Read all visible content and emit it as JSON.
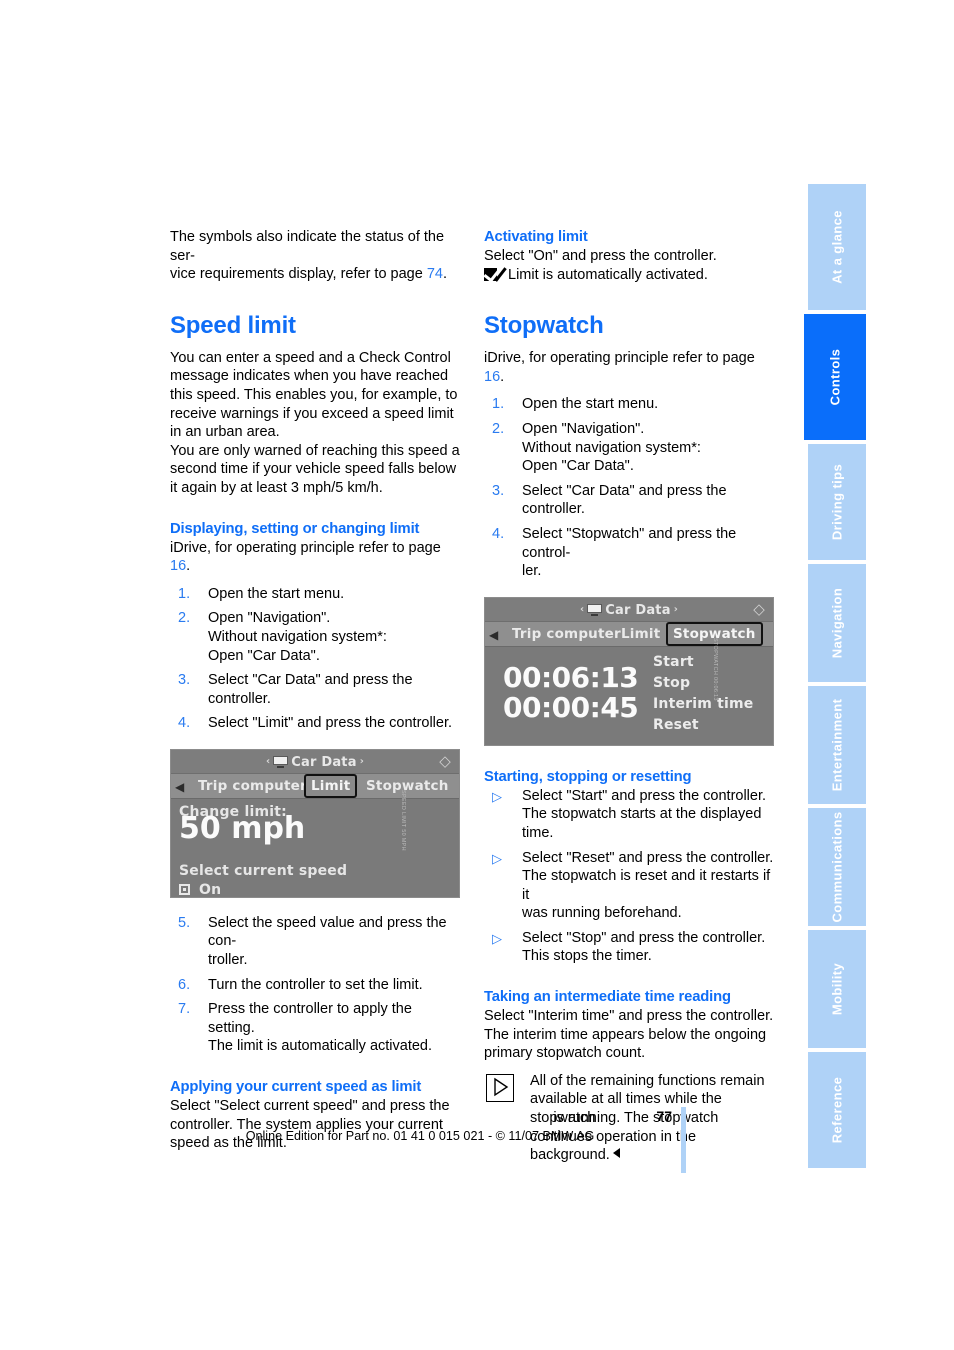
{
  "document": {
    "page_number": "77",
    "edition_line": "Online Edition for Part no. 01 41 0 015 021 - © 11/07 BMW AG"
  },
  "sidenav": {
    "items": [
      {
        "label": "At a glance",
        "active": false
      },
      {
        "label": "Controls",
        "active": true
      },
      {
        "label": "Driving tips",
        "active": false
      },
      {
        "label": "Navigation",
        "active": false
      },
      {
        "label": "Entertainment",
        "active": false
      },
      {
        "label": "Communications",
        "active": false
      },
      {
        "label": "Mobility",
        "active": false
      },
      {
        "label": "Reference",
        "active": false
      }
    ],
    "active_color": "#0a6efa",
    "inactive_color": "#afd2f7"
  },
  "left_column": {
    "intro": {
      "text_before": "The symbols also indicate the status of the ser-vice requirements display, refer to page ",
      "line1": "The symbols also indicate the status of the ser-",
      "line2_before": "vice requirements display, refer to page ",
      "page_ref": "74",
      "line2_after": "."
    },
    "section_title": "Speed limit",
    "intro_para1": "You can enter a speed and a Check Control message indicates when you have reached this speed. This enables you, for example, to receive warnings if you exceed a speed limit in an urban area.",
    "intro_para2": "You are only warned of reaching this speed a second time if your vehicle speed falls below it again by at least 3 mph/5 km/h.",
    "sub1": {
      "heading": "Displaying, setting or changing limit",
      "lead_before": "iDrive, for operating principle refer to page ",
      "lead_ref": "16",
      "lead_after": ".",
      "steps": [
        {
          "num": "1.",
          "lines": [
            "Open the start menu."
          ]
        },
        {
          "num": "2.",
          "lines": [
            "Open \"Navigation\".",
            "Without navigation system*:",
            "Open \"Car Data\"."
          ]
        },
        {
          "num": "3.",
          "lines": [
            "Select \"Car Data\" and press the controller."
          ]
        },
        {
          "num": "4.",
          "lines": [
            "Select \"Limit\" and press the controller."
          ]
        }
      ],
      "steps_after": [
        {
          "num": "5.",
          "lines": [
            "Select the speed value and press the con-",
            "troller."
          ]
        },
        {
          "num": "6.",
          "lines": [
            "Turn the controller to set the limit."
          ]
        },
        {
          "num": "7.",
          "lines": [
            "Press the controller to apply the setting.",
            "The limit is automatically activated."
          ]
        }
      ]
    },
    "sub2": {
      "heading": "Applying your current speed as limit",
      "body": "Select \"Select current speed\" and press the controller. The system applies your current speed as the limit."
    },
    "screenshot": {
      "header_title": "Car Data",
      "header_arrow_left": "‹",
      "header_arrow_right": "›",
      "tabs": [
        {
          "label": "Trip computer",
          "selected": false
        },
        {
          "label": "Limit",
          "selected": true
        },
        {
          "label": "Stopwatch",
          "selected": false
        }
      ],
      "change_limit_label": "Change limit:",
      "limit_value": "50 mph",
      "select_current_speed": "Select current speed",
      "on_label": "On",
      "credit": "SPEED LIMIT 50 MPH"
    }
  },
  "right_column": {
    "sub_activating": {
      "heading": "Activating limit",
      "line1": "Select \"On\" and press the controller.",
      "line2": "Limit is automatically activated."
    },
    "section_title": "Stopwatch",
    "lead_before": "iDrive, for operating principle refer to page ",
    "lead_ref": "16",
    "lead_after": ".",
    "steps": [
      {
        "num": "1.",
        "lines": [
          "Open the start menu."
        ]
      },
      {
        "num": "2.",
        "lines": [
          "Open \"Navigation\".",
          "Without navigation system*:",
          "Open \"Car Data\"."
        ]
      },
      {
        "num": "3.",
        "lines": [
          "Select \"Car Data\" and press the controller."
        ]
      },
      {
        "num": "4.",
        "lines": [
          "Select \"Stopwatch\" and press the control-",
          "ler."
        ]
      }
    ],
    "screenshot": {
      "header_title": "Car Data",
      "header_arrow_left": "‹",
      "header_arrow_right": "›",
      "tabs": [
        {
          "label": "Trip computer",
          "selected": false
        },
        {
          "label": "Limit",
          "selected": false
        },
        {
          "label": "Stopwatch",
          "selected": true
        }
      ],
      "time_primary": "00:06:13",
      "time_interim": "00:00:45",
      "menu": [
        "Start",
        "Stop",
        "Interim time",
        "Reset"
      ],
      "credit": "STOPWATCH 00:06:13"
    },
    "sub_starting": {
      "heading": "Starting, stopping or resetting",
      "bullets": [
        {
          "lines": [
            "Select \"Start\" and press the controller.",
            "The stopwatch starts at the displayed time."
          ]
        },
        {
          "lines": [
            "Select \"Reset\" and press the controller.",
            "The stopwatch is reset and it restarts if it",
            "was running beforehand."
          ]
        },
        {
          "lines": [
            "Select \"Stop\" and press the controller.",
            "This stops the timer."
          ]
        }
      ]
    },
    "sub_interim": {
      "heading": "Taking an intermediate time reading",
      "body": "Select \"Interim time\" and press the controller. The interim time appears below the ongoing primary stopwatch count.",
      "note_indented": "All of the remaining functions remain available at all times while the stopwatch",
      "note_rest": "is running. The stopwatch continues operation in the background."
    }
  }
}
